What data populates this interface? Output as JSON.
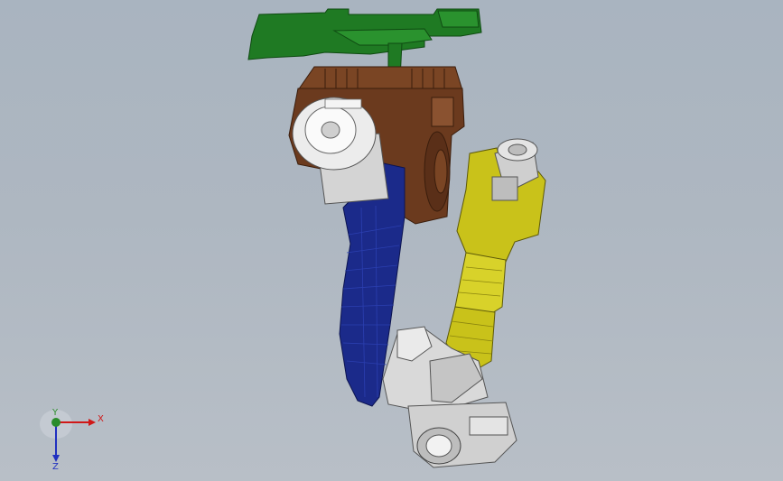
{
  "viewport": {
    "background_top": "#a9b4c0",
    "background_bottom": "#b8bfc7"
  },
  "model": {
    "parts": [
      {
        "name": "mounting-bracket",
        "color": "#1f7a23"
      },
      {
        "name": "base-housing",
        "color": "#6b3a1e"
      },
      {
        "name": "shoulder-motor",
        "color": "#e6e6e6"
      },
      {
        "name": "lower-arm",
        "color": "#1b2a8a"
      },
      {
        "name": "upper-arm",
        "color": "#c9c21a"
      },
      {
        "name": "elbow-joint",
        "color": "#d9d9d9"
      },
      {
        "name": "wrist-flange",
        "color": "#cfcfcf"
      }
    ]
  },
  "triad": {
    "x_label": "X",
    "y_label": "Y",
    "z_label": "Z",
    "x_color": "#d01818",
    "y_color": "#2a8c2a",
    "z_color": "#2030c0"
  }
}
